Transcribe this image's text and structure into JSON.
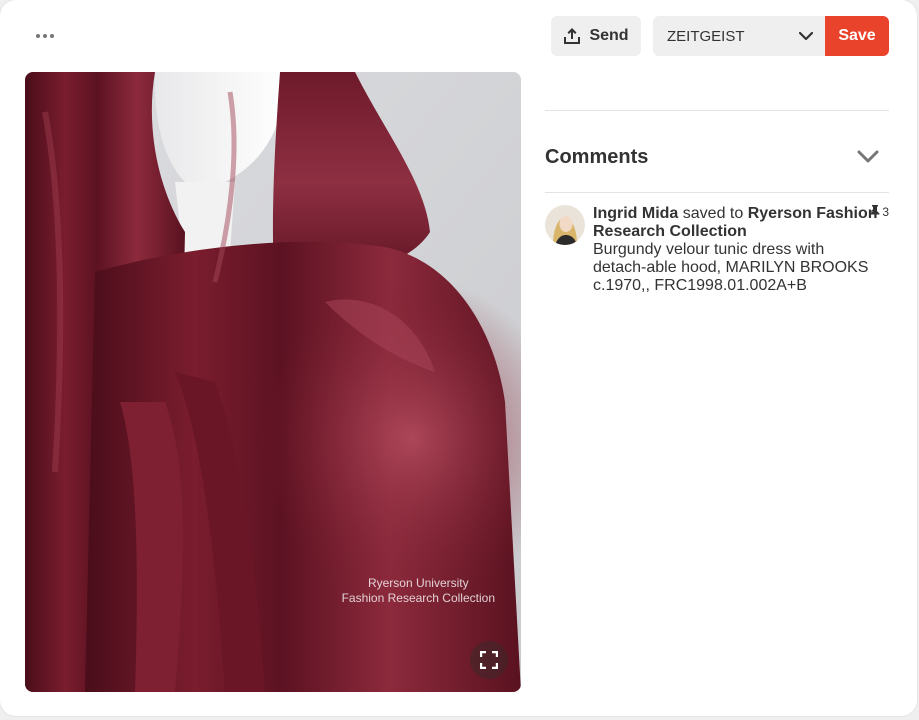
{
  "toolbar": {
    "more_icon": "ellipsis-icon",
    "send_label": "Send",
    "send_icon": "share-upload-icon",
    "board_selected": "ZEITGEIST",
    "save_label": "Save",
    "save_color": "#e9432b"
  },
  "pin": {
    "watermark_line1": "Ryerson University",
    "watermark_line2": "Fashion Research Collection",
    "expand_icon": "fullscreen-icon"
  },
  "comments": {
    "title": "Comments",
    "toggle_icon": "chevron-down-icon"
  },
  "activity": {
    "user": "Ingrid Mida",
    "action": "saved to",
    "board": "Ryerson Fashion Research Collection",
    "description": "Burgundy velour tunic dress with detach-able hood, MARILYN BROOKS c.1970,, FRC1998.01.002A+B",
    "repin_count": "3",
    "repin_icon": "pin-icon"
  }
}
